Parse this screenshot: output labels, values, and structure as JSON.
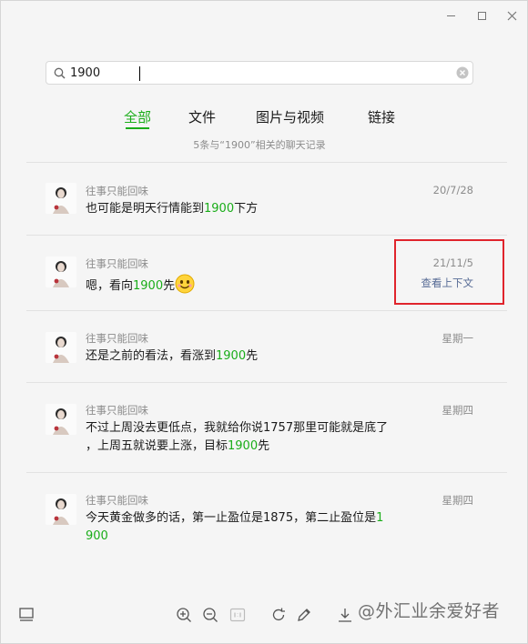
{
  "search": {
    "value": "1900"
  },
  "tabs": [
    {
      "label": "全部",
      "active": true
    },
    {
      "label": "文件",
      "active": false
    },
    {
      "label": "图片与视频",
      "active": false
    },
    {
      "label": "链接",
      "active": false
    }
  ],
  "summary": "5条与“1900”相关的聊天记录",
  "results": [
    {
      "sender": "往事只能回味",
      "date": "20/7/28",
      "parts": [
        "也可能是明天行情能到",
        "1900",
        "下方"
      ]
    },
    {
      "sender": "往事只能回味",
      "date": "21/11/5",
      "context_link": "查看上下文",
      "parts": [
        "嗯，看向",
        "1900",
        "先"
      ],
      "emoji": "smile-emoji"
    },
    {
      "sender": "往事只能回味",
      "date": "星期一",
      "parts": [
        "还是之前的看法，看涨到",
        "1900",
        "先"
      ]
    },
    {
      "sender": "往事只能回味",
      "date": "星期四",
      "parts": [
        "不过上周没去更低点，我就给你说1757那里可能就是底了",
        "，上周五就说要上涨，目标",
        "1900",
        "先"
      ]
    },
    {
      "sender": "往事只能回味",
      "date": "星期四",
      "parts": [
        "今天黄金做多的话，第一止盈位是1875，第二止盈位是",
        "1",
        "900"
      ]
    }
  ],
  "toolbar": {
    "icons": [
      "sidebar-toggle-icon",
      "zoom-in-icon",
      "zoom-out-icon",
      "actual-size-icon",
      "rotate-icon",
      "edit-icon",
      "download-icon"
    ]
  },
  "watermark": "@外汇业余爱好者",
  "colors": {
    "highlight": "#1aad19",
    "link": "#576b95",
    "annotation": "#e0242c"
  }
}
